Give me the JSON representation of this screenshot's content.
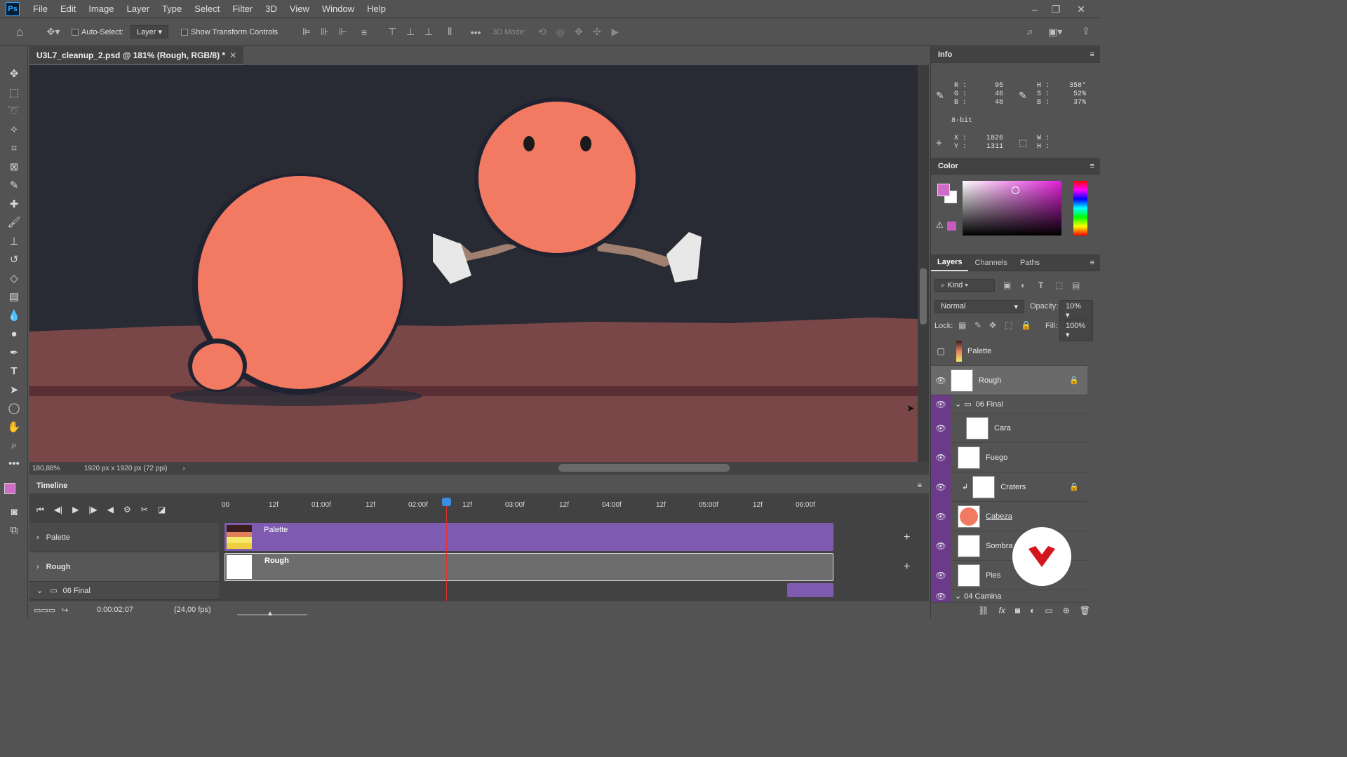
{
  "app": {
    "logo": "Ps"
  },
  "menu": [
    "File",
    "Edit",
    "Image",
    "Layer",
    "Type",
    "Select",
    "Filter",
    "3D",
    "View",
    "Window",
    "Help"
  ],
  "options": {
    "auto_select_label": "Auto-Select:",
    "auto_select_value": "Layer",
    "show_transform_label": "Show Transform Controls",
    "mode_3d_label": "3D Mode:"
  },
  "document": {
    "tab_title": "U3L7_cleanup_2.psd @ 181% (Rough, RGB/8) *",
    "zoom": "180,88%",
    "doc_info": "1920 px x 1920 px (72 ppi)"
  },
  "info": {
    "title": "Info",
    "r_label": "R :",
    "r": "95",
    "g_label": "G :",
    "g": "46",
    "b_label": "B :",
    "b": "48",
    "h_label": "H :",
    "h": "358°",
    "s_label": "S :",
    "s": "52%",
    "bb_label": "B :",
    "bb": "37%",
    "bitdepth": "8-bit",
    "x_label": "X :",
    "x": "1826",
    "y_label": "Y :",
    "y": "1311",
    "w_label": "W :",
    "h2_label": "H :"
  },
  "color": {
    "title": "Color",
    "fg": "#d16bc8",
    "bg": "#ffffff"
  },
  "layers_panel": {
    "tabs": [
      "Layers",
      "Channels",
      "Paths"
    ],
    "filter": "Kind",
    "blend": "Normal",
    "opacity_label": "Opacity:",
    "opacity": "10%",
    "lock_label": "Lock:",
    "fill_label": "Fill:",
    "fill": "100%",
    "layers": [
      {
        "name": "Palette",
        "visible": false
      },
      {
        "name": "Rough",
        "visible": true,
        "locked": true
      },
      {
        "name": "06 Final",
        "group": true,
        "visible": true
      },
      {
        "name": "Cara",
        "visible": true
      },
      {
        "name": "Fuego",
        "visible": true
      },
      {
        "name": "Craters",
        "visible": true,
        "locked": true
      },
      {
        "name": "Cabeza",
        "visible": true
      },
      {
        "name": "Sombra",
        "visible": true
      },
      {
        "name": "Pies",
        "visible": true
      },
      {
        "name": "04 Camina",
        "group": true,
        "visible": true
      }
    ]
  },
  "timeline": {
    "title": "Timeline",
    "ruler": [
      "00",
      "12f",
      "01:00f",
      "12f",
      "02:00f",
      "12f",
      "03:00f",
      "12f",
      "04:00f",
      "12f",
      "05:00f",
      "12f",
      "06:00f"
    ],
    "tracks": [
      {
        "name": "Palette",
        "clip": "Palette"
      },
      {
        "name": "Rough",
        "clip": "Rough"
      },
      {
        "name": "06 Final"
      }
    ],
    "timecode": "0:00:02:07",
    "fps": "(24,00 fps)"
  }
}
